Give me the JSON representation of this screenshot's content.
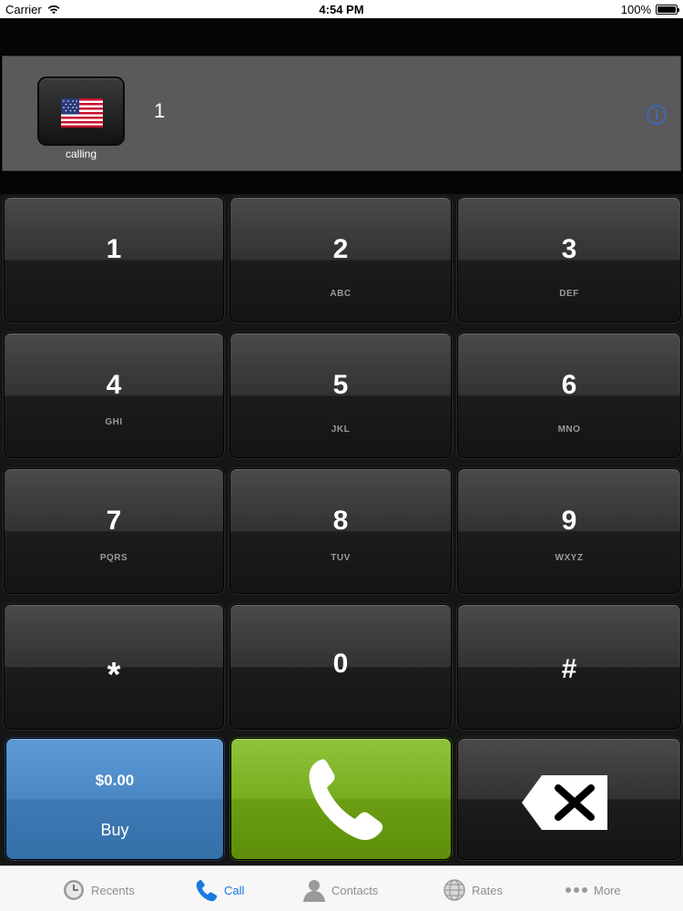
{
  "status_bar": {
    "carrier": "Carrier",
    "time": "4:54 PM",
    "battery": "100%"
  },
  "display": {
    "flag_icon": "us-flag-icon",
    "calling_label": "calling",
    "number": "1",
    "info_icon": "info-circle-icon"
  },
  "keypad": {
    "keys": [
      {
        "digit": "1",
        "letters": ""
      },
      {
        "digit": "2",
        "letters": "ABC"
      },
      {
        "digit": "3",
        "letters": "DEF"
      },
      {
        "digit": "4",
        "letters": "GHI"
      },
      {
        "digit": "5",
        "letters": "JKL"
      },
      {
        "digit": "6",
        "letters": "MNO"
      },
      {
        "digit": "7",
        "letters": "PQRS"
      },
      {
        "digit": "8",
        "letters": "TUV"
      },
      {
        "digit": "9",
        "letters": "WXYZ"
      },
      {
        "digit": "*",
        "letters": ""
      },
      {
        "digit": "0",
        "letters": ""
      },
      {
        "digit": "#",
        "letters": ""
      }
    ],
    "buy": {
      "balance": "$0.00",
      "label": "Buy"
    },
    "call_icon": "phone-icon",
    "backspace_icon": "backspace-icon"
  },
  "tab_bar": {
    "tabs": [
      {
        "label": "Recents",
        "icon": "clock-icon"
      },
      {
        "label": "Call",
        "icon": "phone-icon",
        "active": true
      },
      {
        "label": "Contacts",
        "icon": "person-icon"
      },
      {
        "label": "Rates",
        "icon": "globe-icon"
      },
      {
        "label": "More",
        "icon": "more-icon"
      }
    ]
  },
  "colors": {
    "buy_button": "#4a87c4",
    "call_button": "#78ad1f",
    "active_tab": "#1a7ae0",
    "display_bg": "#5b595b"
  }
}
